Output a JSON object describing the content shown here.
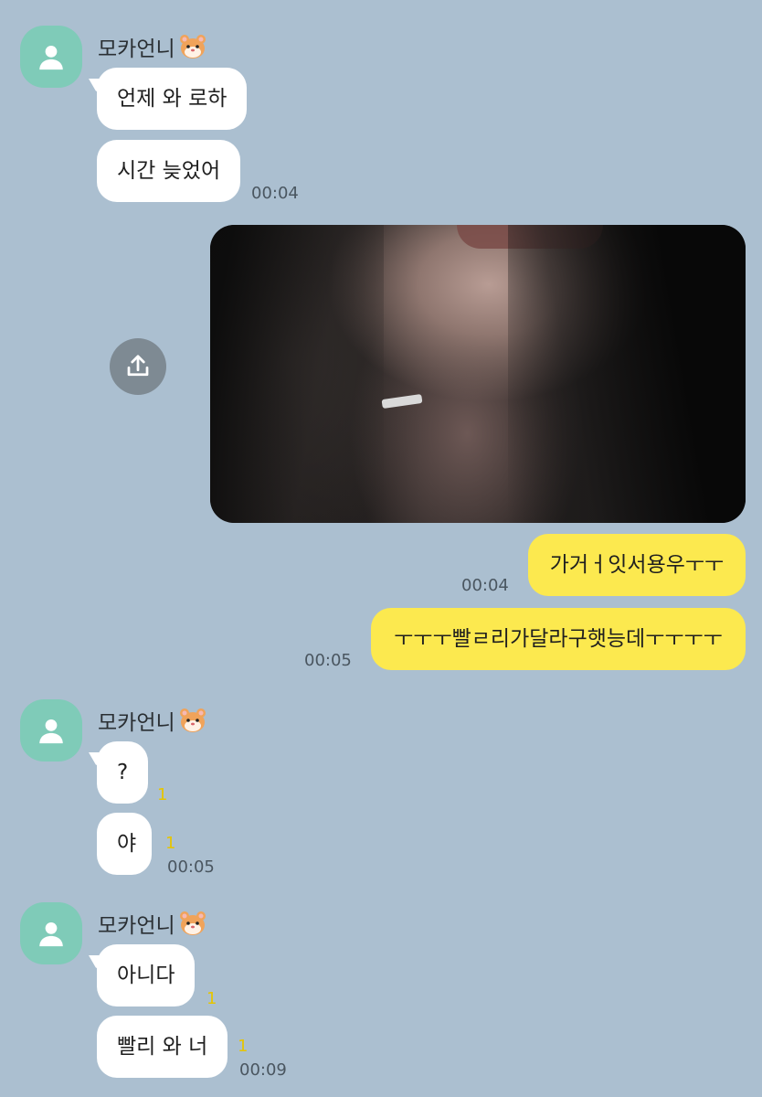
{
  "groups": [
    {
      "sender": "모카언니",
      "messages": [
        {
          "text": "언제 와 로하"
        },
        {
          "text": "시간 늦었어",
          "time": "00:04"
        }
      ]
    },
    {
      "sender": "모카언니",
      "messages": [
        {
          "text": "?",
          "unread": "1"
        },
        {
          "text": "야",
          "unread": "1",
          "time": "00:05"
        }
      ]
    },
    {
      "sender": "모카언니",
      "messages": [
        {
          "text": "아니다",
          "unread": "1"
        },
        {
          "text": "빨리 와 너",
          "unread": "1",
          "time": "00:09"
        }
      ]
    }
  ],
  "outgoing": [
    {
      "text": "가거ㅓ잇서용우ㅜㅜ",
      "time": "00:04"
    },
    {
      "text": "ㅜㅜㅜ빨ㄹ리가달라구햇능데ㅜㅜㅜㅜ",
      "time": "00:05"
    }
  ],
  "icons": {
    "avatar": "person-icon",
    "sender_badge": "hamster-icon",
    "share": "share-upload-icon"
  },
  "colors": {
    "background": "#abbfd0",
    "incoming_bubble": "#ffffff",
    "outgoing_bubble": "#fce94f",
    "avatar": "#7fcbb8",
    "unread": "#e6c500"
  }
}
